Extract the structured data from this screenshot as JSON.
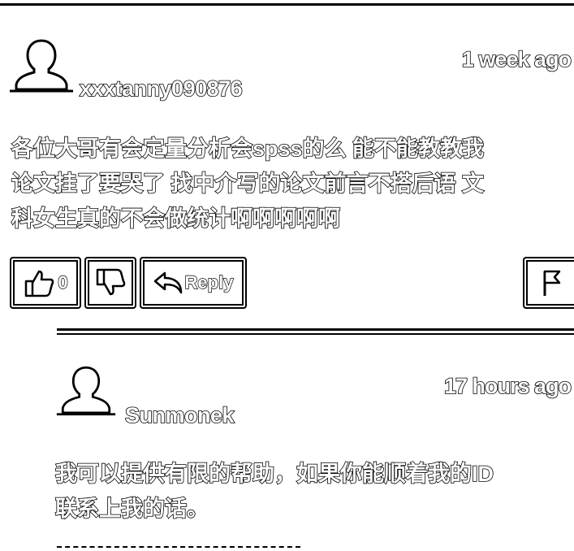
{
  "comments": [
    {
      "username": "xxxtanny090876",
      "timestamp": "1 week ago",
      "text_lines": [
        "各位大哥有会定量分析会spss的么 能不能教教我",
        "论文挂了要哭了 找中介写的论文前言不搭后语 文",
        "科女生真的不会做统计啊啊啊啊啊"
      ],
      "like_count": "0",
      "reply_label": "Reply"
    },
    {
      "username": "Sunmonek",
      "timestamp": "17 hours ago",
      "text_lines": [
        "我可以提供有限的帮助，如果你能顺着我的ID",
        "联系上我的话。"
      ]
    }
  ]
}
